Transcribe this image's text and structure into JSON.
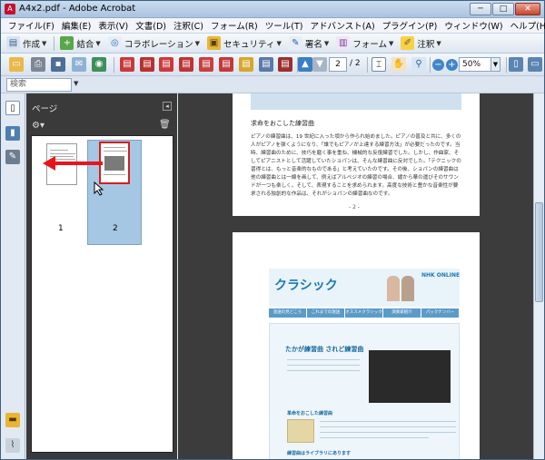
{
  "window": {
    "title": "A4x2.pdf - Adobe Acrobat",
    "buttons": {
      "minimize": "─",
      "maximize": "□",
      "close": "✕"
    }
  },
  "menubar": {
    "items": [
      "ファイル(F)",
      "編集(E)",
      "表示(V)",
      "文書(D)",
      "注釈(C)",
      "フォーム(R)",
      "ツール(T)",
      "アドバンスト(A)",
      "プラグイン(P)",
      "ウィンドウ(W)",
      "ヘルプ(H)"
    ]
  },
  "tasks": {
    "create": "作成",
    "combine": "結合",
    "collaboration": "コラボレーション",
    "security": "セキュリティ",
    "sign": "署名",
    "forms": "フォーム",
    "comment": "注釈"
  },
  "toolbar": {
    "current_page": "2",
    "total_pages": "/ 2",
    "zoom": "50%"
  },
  "search": {
    "placeholder": "検索"
  },
  "pages_panel": {
    "title": "ページ",
    "thumbnails": [
      {
        "number": "1",
        "selected": false
      },
      {
        "number": "2",
        "selected": true
      }
    ]
  },
  "document": {
    "page1": {
      "heading": "求命をおこした練習曲",
      "body": "ピアノの練習曲は、19 世紀に入った頃から作られ始めました。ピアノの普及と共に、多くの人がピアノを弾くようになり、「誰でもピアノが上達する練習方法」が必要だったのです。当時、練習曲のために、技巧を磨く事を重ね、機械的な反復練習でした。しかし、作曲家、そしてピアニストとして活躍していたショパンは、そんな練習曲に反対でした。「テクニックの習得とは、もっと音楽的なものである」と考えていたのです。その後、ショパンの練習曲は他の練習曲とは一線を画して、例えばアルペジオの練習の場合、緩から華の運びそのサウンドが一つも楽しく。そして、表現することを求められます。高度な技術と豊かな音楽性が要求される独創的な作品は、それがショパンの練習曲なのです。",
      "page_number": "- 2 -"
    },
    "page2": {
      "logo": "クラシック",
      "brand": "NHK ONLINE",
      "nav": [
        "放送の見どころ",
        "これまでの放送",
        "オススメクラシック",
        "演奏家紹介",
        "パックナンバー"
      ],
      "section_title": "たかが練習曲 されど練習曲",
      "sub1": "革命をおこした練習曲",
      "sub2": "練習曲はライブラリにあります"
    }
  },
  "colors": {
    "title_bar": "#aac4df",
    "panel_dark": "#3a3a3a",
    "selection": "#a6c7e3",
    "annotation_arrow": "#e8141c"
  }
}
